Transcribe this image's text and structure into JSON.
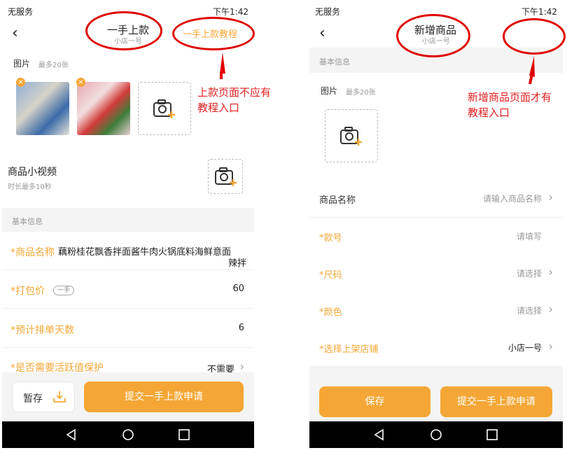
{
  "left_phone": {
    "status": {
      "carrier": "无服务",
      "time": "下午1:42"
    },
    "header": {
      "title": "一手上款",
      "subtitle": "小店一号",
      "tutorial_link": "一手上款教程"
    },
    "photos": {
      "label": "图片",
      "hint": "最多20张"
    },
    "video": {
      "label": "商品小视频",
      "hint": "时长最多10秒"
    },
    "section_title": "基本信息",
    "rows": {
      "name_label": "*商品名称",
      "name_value": "藕粉桂花飘香拌面酱牛肉火锅底料海鲜意面",
      "name_overflow": "辣拌",
      "price_label": "*打包价",
      "price_tag": "一手",
      "price_value": "60",
      "days_label": "*预计排单天数",
      "days_value": "6",
      "protect_label": "*是否需要活跃值保护",
      "protect_value": "不需要"
    },
    "footer": {
      "draft": "暂存",
      "submit": "提交一手上款申请"
    }
  },
  "right_phone": {
    "status": {
      "carrier": "无服务",
      "time": "下午1:42"
    },
    "header": {
      "title": "新增商品",
      "subtitle": "小店一号"
    },
    "section_title": "基本信息",
    "photos": {
      "label": "图片",
      "hint": "最多20张"
    },
    "rows": [
      {
        "label": "商品名称",
        "value": "请输入商品名称",
        "required": false,
        "chevron": true
      },
      {
        "label": "*款号",
        "value": "请填写",
        "required": true,
        "chevron": false
      },
      {
        "label": "*尺码",
        "value": "请选择",
        "required": true,
        "chevron": true
      },
      {
        "label": "*颜色",
        "value": "请选择",
        "required": true,
        "chevron": true
      },
      {
        "label": "*选择上架店铺",
        "value": "小店一号",
        "required": true,
        "chevron": true
      }
    ],
    "footer": {
      "save": "保存",
      "submit": "提交一手上款申请"
    }
  },
  "annotations": {
    "left": "上款页面不应有\n教程入口",
    "right": "新增商品页面才有\n教程入口"
  },
  "colors": {
    "accent": "#f4a736",
    "annotation": "#e00000"
  }
}
